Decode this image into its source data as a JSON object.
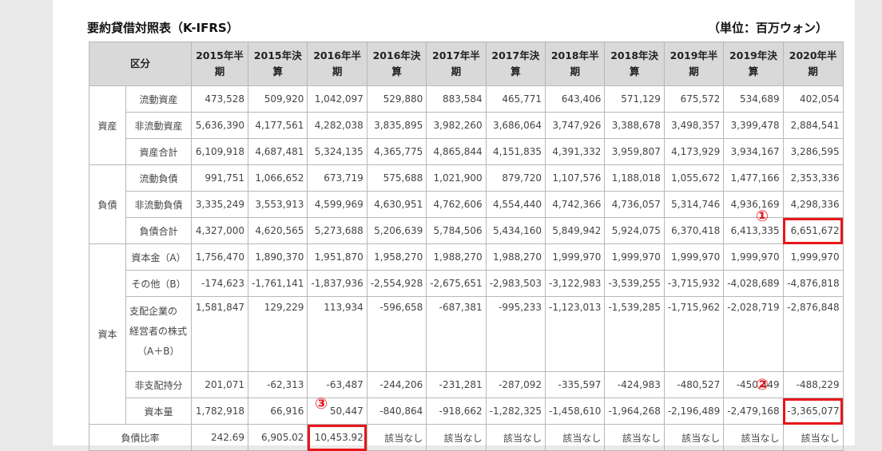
{
  "title": "要約貸借対照表（K-IFRS）",
  "unit": "（単位：百万ウォン）",
  "header": {
    "category": "区分",
    "periods": [
      [
        "2015年半",
        "期"
      ],
      [
        "2015年決",
        "算"
      ],
      [
        "2016年半",
        "期"
      ],
      [
        "2016年決",
        "算"
      ],
      [
        "2017年半",
        "期"
      ],
      [
        "2017年決",
        "算"
      ],
      [
        "2018年半",
        "期"
      ],
      [
        "2018年決",
        "算"
      ],
      [
        "2019年半",
        "期"
      ],
      [
        "2019年決",
        "算"
      ],
      [
        "2020年半",
        "期"
      ]
    ]
  },
  "groups": [
    {
      "name": "資産",
      "rows": [
        {
          "label": "流動資産",
          "values": [
            "473,528",
            "509,920",
            "1,042,097",
            "529,880",
            "883,584",
            "465,771",
            "643,406",
            "571,129",
            "675,572",
            "534,689",
            "402,054"
          ]
        },
        {
          "label": "非流動資産",
          "values": [
            "5,636,390",
            "4,177,561",
            "4,282,038",
            "3,835,895",
            "3,982,260",
            "3,686,064",
            "3,747,926",
            "3,388,678",
            "3,498,357",
            "3,399,478",
            "2,884,541"
          ]
        },
        {
          "label": "資産合計",
          "values": [
            "6,109,918",
            "4,687,481",
            "5,324,135",
            "4,365,775",
            "4,865,844",
            "4,151,835",
            "4,391,332",
            "3,959,807",
            "4,173,929",
            "3,934,167",
            "3,286,595"
          ]
        }
      ]
    },
    {
      "name": "負債",
      "rows": [
        {
          "label": "流動負債",
          "values": [
            "991,751",
            "1,066,652",
            "673,719",
            "575,688",
            "1,021,900",
            "879,720",
            "1,107,576",
            "1,188,018",
            "1,055,672",
            "1,477,166",
            "2,353,336"
          ]
        },
        {
          "label": "非流動負債",
          "values": [
            "3,335,249",
            "3,553,913",
            "4,599,969",
            "4,630,951",
            "4,762,606",
            "4,554,440",
            "4,742,366",
            "4,736,057",
            "5,314,746",
            "4,936,169",
            "4,298,336"
          ]
        },
        {
          "label": "負債合計",
          "values": [
            "4,327,000",
            "4,620,565",
            "5,273,688",
            "5,206,639",
            "5,784,506",
            "5,434,160",
            "5,849,942",
            "5,924,075",
            "6,370,418",
            "6,413,335",
            "6,651,672"
          ]
        }
      ]
    },
    {
      "name": "資本",
      "rows": [
        {
          "label": "資本金（A）",
          "values": [
            "1,756,470",
            "1,890,370",
            "1,951,870",
            "1,958,270",
            "1,988,270",
            "1,988,270",
            "1,999,970",
            "1,999,970",
            "1,999,970",
            "1,999,970",
            "1,999,970"
          ]
        },
        {
          "label": "その他（B）",
          "values": [
            "-174,623",
            "-1,761,141",
            "-1,837,936",
            "-2,554,928",
            "-2,675,651",
            "-2,983,503",
            "-3,122,983",
            "-3,539,255",
            "-3,715,932",
            "-4,028,689",
            "-4,876,818"
          ]
        },
        {
          "label": "支配企業の経営者の株式（A＋B）",
          "lines": [
            "支配企業の",
            "経営者の株式",
            "（A＋B）"
          ],
          "values": [
            "1,581,847",
            "129,229",
            "113,934",
            "-596,658",
            "-687,381",
            "-995,233",
            "-1,123,013",
            "-1,539,285",
            "-1,715,962",
            "-2,028,719",
            "-2,876,848"
          ]
        },
        {
          "label": "非支配持分",
          "values": [
            "201,071",
            "-62,313",
            "-63,487",
            "-244,206",
            "-231,281",
            "-287,092",
            "-335,597",
            "-424,983",
            "-480,527",
            "-450,449",
            "-488,229"
          ]
        },
        {
          "label": "資本量",
          "values": [
            "1,782,918",
            "66,916",
            "50,447",
            "-840,864",
            "-918,662",
            "-1,282,325",
            "-1,458,610",
            "-1,964,268",
            "-2,196,489",
            "-2,479,168",
            "-3,365,077"
          ]
        }
      ]
    }
  ],
  "ratio": {
    "label": "負債比率",
    "values": [
      "242.69",
      "6,905.02",
      "10,453.92",
      "該当なし",
      "該当なし",
      "該当なし",
      "該当なし",
      "該当なし",
      "該当なし",
      "該当なし",
      "該当なし"
    ]
  },
  "annotations": [
    "①",
    "②",
    "③"
  ],
  "colors": {
    "highlight": "#e8161b",
    "header_bg": "#d9d9d9",
    "border": "#b8b8b8"
  }
}
